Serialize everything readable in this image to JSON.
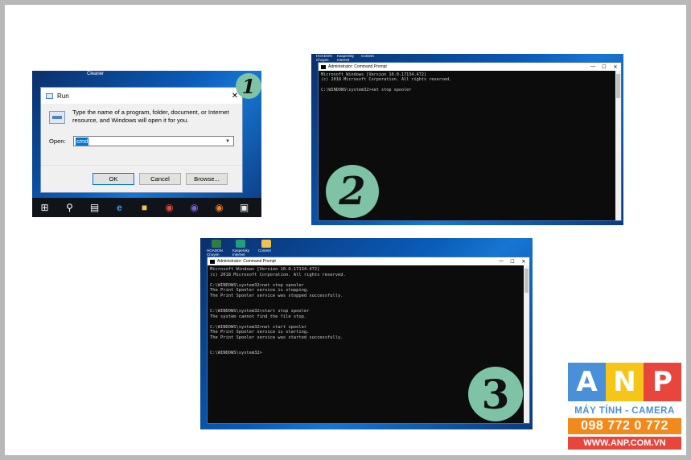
{
  "panel1": {
    "step_number": "1",
    "desktop_label": "Cleaner",
    "run": {
      "title": "Run",
      "description": "Type the name of a program, folder, document, or Internet resource, and Windows will open it for you.",
      "open_label": "Open:",
      "open_value": "cmd",
      "ok": "OK",
      "cancel": "Cancel",
      "browse": "Browse..."
    },
    "taskbar_icons": [
      "windows-start-icon",
      "search-icon",
      "task-view-icon",
      "edge-icon",
      "file-explorer-icon",
      "chrome-icon",
      "firefox-icon",
      "firefox-icon",
      "store-icon"
    ]
  },
  "panel2": {
    "step_number": "2",
    "desktop_labels": [
      "HOADON Chuyen",
      "Kaspersky Internet",
      "Content"
    ],
    "window_title": "Administrator: Command Prompt",
    "console": "Microsoft Windows [Version 10.0.17134.472]\n(c) 2018 Microsoft Corporation. All rights reserved.\n\nC:\\WINDOWS\\system32>net stop spooler"
  },
  "panel3": {
    "step_number": "3",
    "desktop_labels": [
      "HOADON Chuyen",
      "Kaspersky Internet",
      "Content"
    ],
    "window_title": "Administrator: Command Prompt",
    "console": "Microsoft Windows [Version 10.0.17134.472]\n(c) 2018 Microsoft Corporation. All rights reserved.\n\nC:\\WINDOWS\\system32>net stop spooler\nThe Print Spooler service is stopping.\nThe Print Spooler service was stopped successfully.\n\n\nC:\\WINDOWS\\system32>start stop spooler\nThe system cannot find the file stop.\n\nC:\\WINDOWS\\system32>net start spooler\nThe Print Spooler service is starting.\nThe Print Spooler service was started successfully.\n\n\nC:\\WINDOWS\\system32>"
  },
  "logo": {
    "letters": [
      "A",
      "N",
      "P"
    ],
    "tagline": "MÁY TÍNH - CAMERA",
    "phone": "098 772 0 772",
    "website": "WWW.ANP.COM.VN",
    "colors": {
      "a": "#4a90d9",
      "n": "#f5c518",
      "p": "#e8453c"
    }
  },
  "window_controls": {
    "minimize": "—",
    "maximize": "☐",
    "close": "✕"
  }
}
